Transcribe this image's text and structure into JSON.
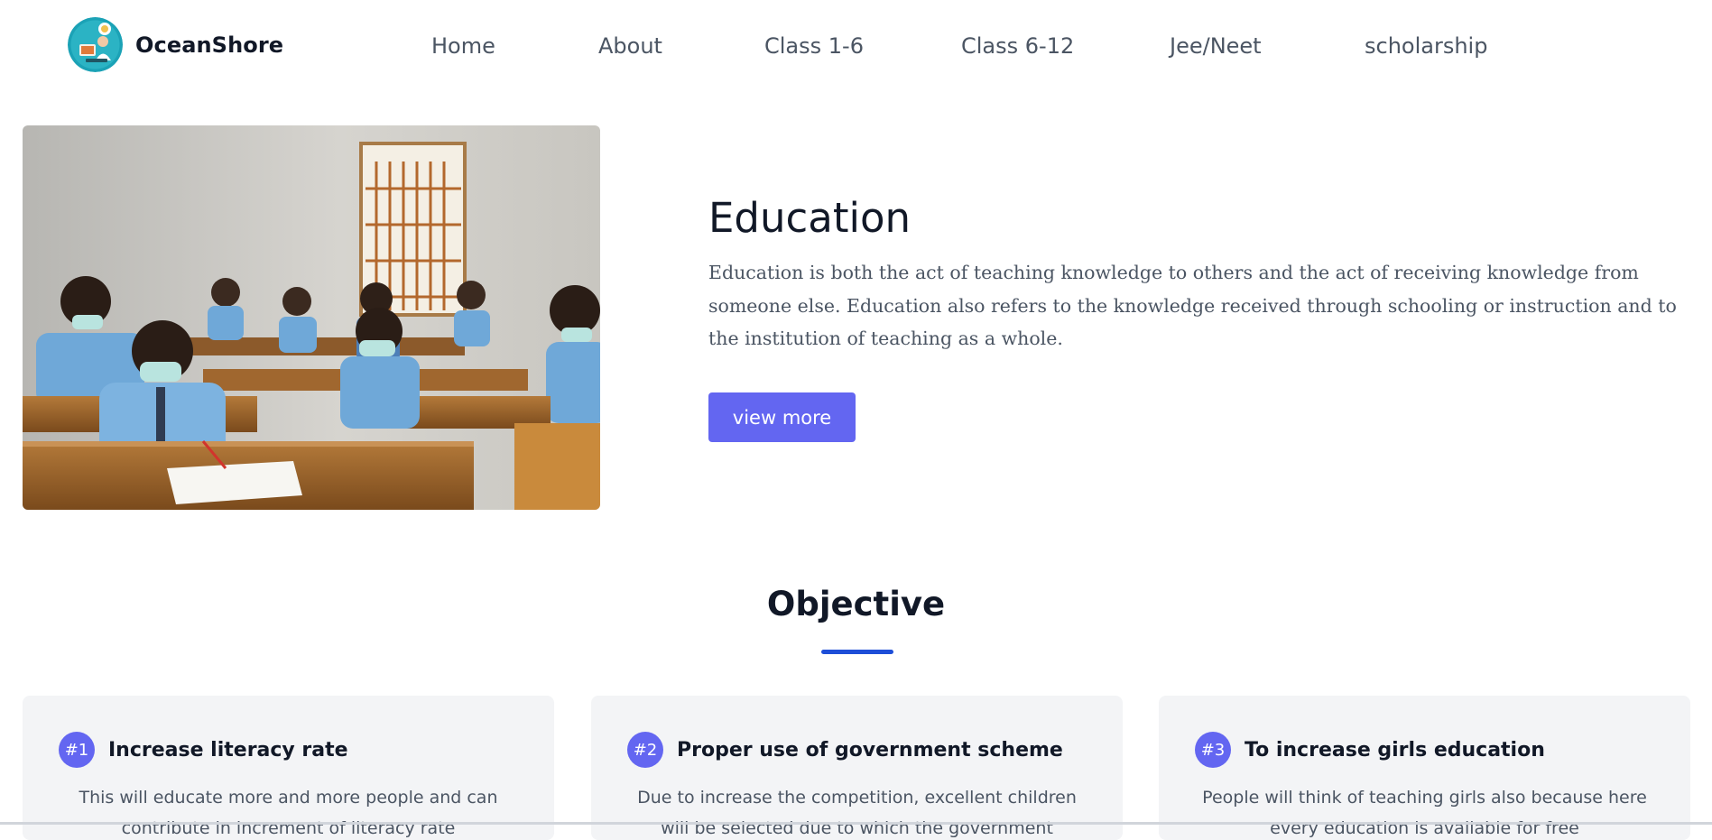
{
  "brand": {
    "name": "OceanShore",
    "logo_icon": "book-reader-logo-icon"
  },
  "nav": {
    "items": [
      {
        "label": "Home"
      },
      {
        "label": "About"
      },
      {
        "label": "Class 1-6"
      },
      {
        "label": "Class 6-12"
      },
      {
        "label": "Jee/Neet"
      },
      {
        "label": "scholarship"
      }
    ]
  },
  "hero": {
    "image_icon": "classroom-photo",
    "title": "Education",
    "text": "Education is both the act of teaching knowledge to others and the act of receiving knowledge from someone else. Education also refers to the knowledge received through schooling or instruction and to the institution of teaching as a whole.",
    "button_label": "view more"
  },
  "objective": {
    "title": "Objective",
    "cards": [
      {
        "badge": "#1",
        "title": "Increase literacy rate",
        "text": "This will educate more and more people and can contribute in increment of literacy rate"
      },
      {
        "badge": "#2",
        "title": "Proper use of government scheme",
        "text": "Due to increase the competition, excellent children will be selected due to which the government scheme will be used properly"
      },
      {
        "badge": "#3",
        "title": "To increase girls education",
        "text": "People will think of teaching girls also because here every education is available for free"
      }
    ]
  },
  "colors": {
    "accent": "#6366f1",
    "underline": "#1d4ed8",
    "card_bg": "#f3f4f6",
    "heading": "#111827",
    "body_text": "#4b5563"
  }
}
